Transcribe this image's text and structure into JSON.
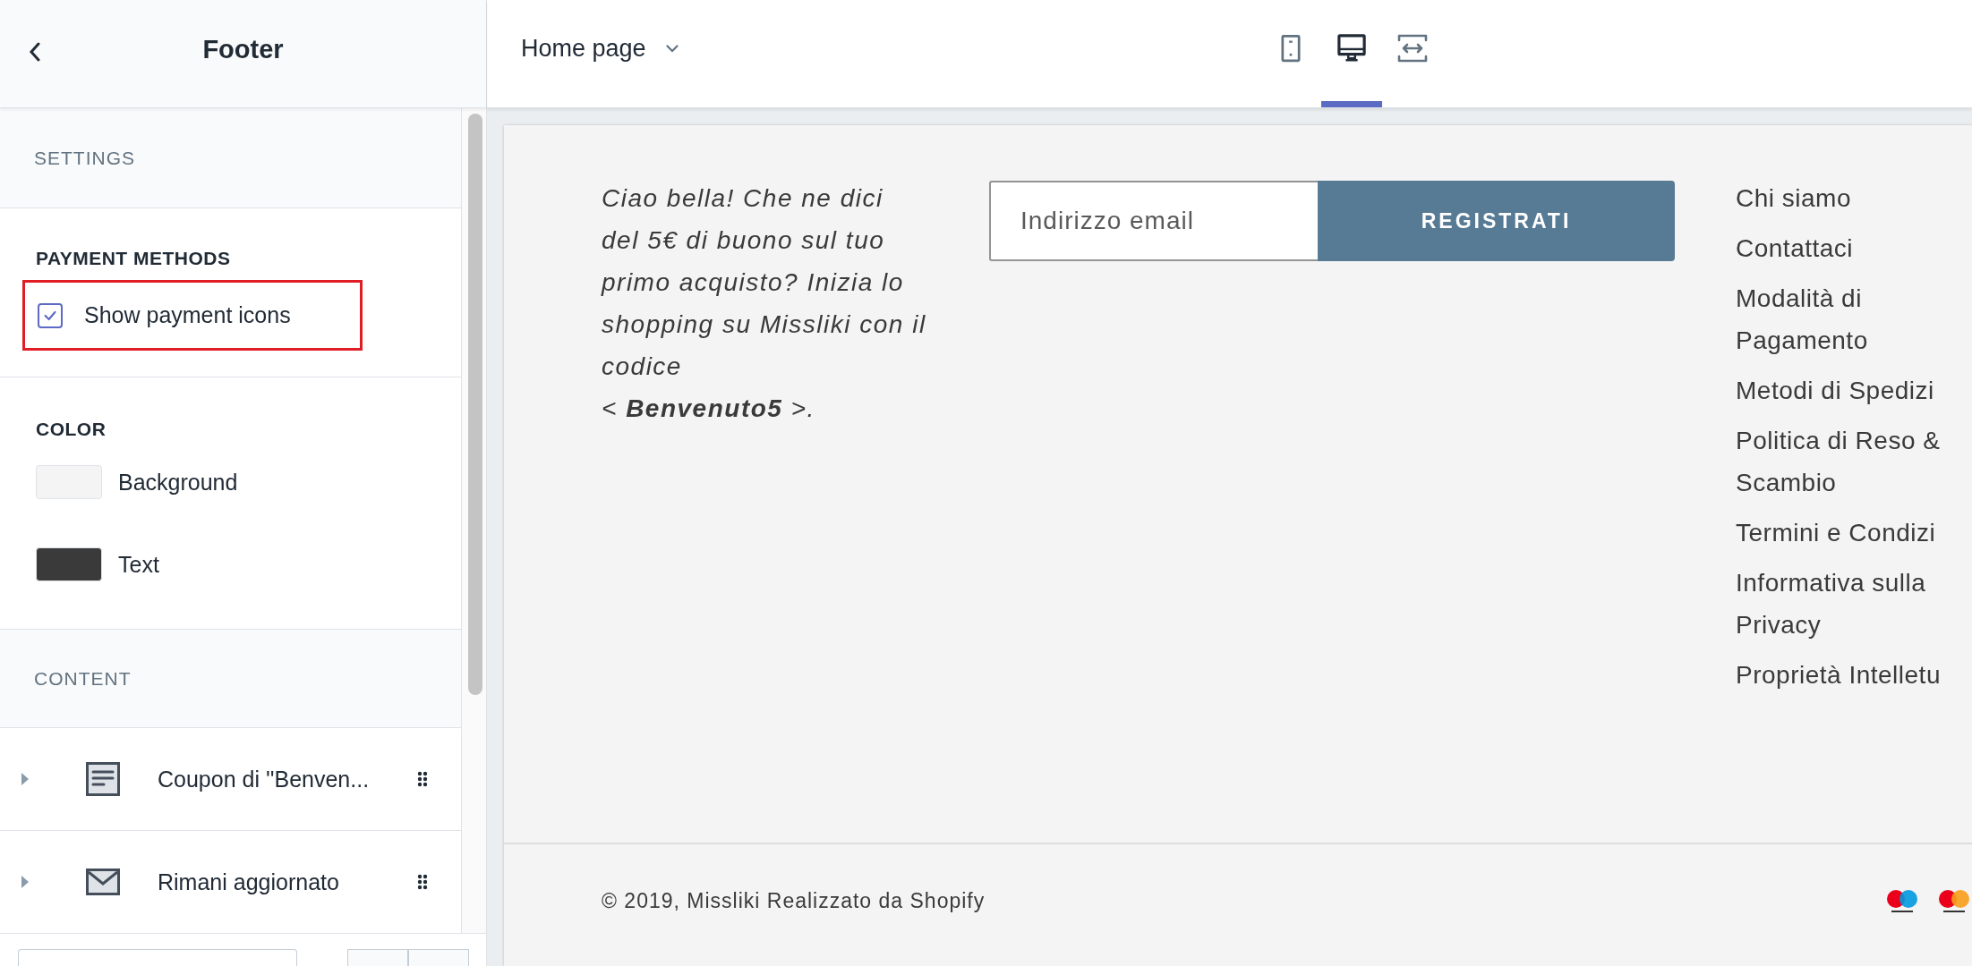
{
  "sidebar": {
    "title": "Footer",
    "settings_heading": "SETTINGS",
    "payment_methods": {
      "heading": "PAYMENT METHODS",
      "checkbox": {
        "label": "Show payment icons",
        "checked": true,
        "highlighted": true
      }
    },
    "color": {
      "heading": "COLOR",
      "swatches": [
        {
          "label": "Background",
          "color": "#f4f4f4"
        },
        {
          "label": "Text",
          "color": "#3a3a3a"
        }
      ]
    },
    "content_heading": "CONTENT",
    "blocks": [
      {
        "label": "Coupon di ''Benven...",
        "kind": "text"
      },
      {
        "label": "Rimani aggiornato",
        "kind": "newsletter"
      }
    ]
  },
  "topbar": {
    "page": "Home page",
    "devices": [
      {
        "kind": "mobile",
        "selected": false
      },
      {
        "kind": "desktop",
        "selected": true
      },
      {
        "kind": "fullscreen",
        "selected": false
      }
    ]
  },
  "preview": {
    "message": "Ciao bella! Che ne dici del 5€ di buono sul tuo primo acquisto? Inizia lo shopping su Missliki con il codice\n< **Benvenuto5** >.",
    "email": {
      "placeholder": "Indirizzo email"
    },
    "button": "REGISTRATI",
    "links": [
      "Chi siamo",
      "Contattaci",
      "Modalità di Pagamento",
      "Metodi di Spedizi",
      "Politica di Reso & Scambio",
      "Termini e Condizi",
      "Informativa sulla Privacy",
      "Proprietà Intelletu"
    ],
    "copyright": "© 2019, Missliki Realizzato da Shopify",
    "payment_icons": [
      {
        "kind": "maestro"
      },
      {
        "kind": "mastercard"
      }
    ]
  }
}
